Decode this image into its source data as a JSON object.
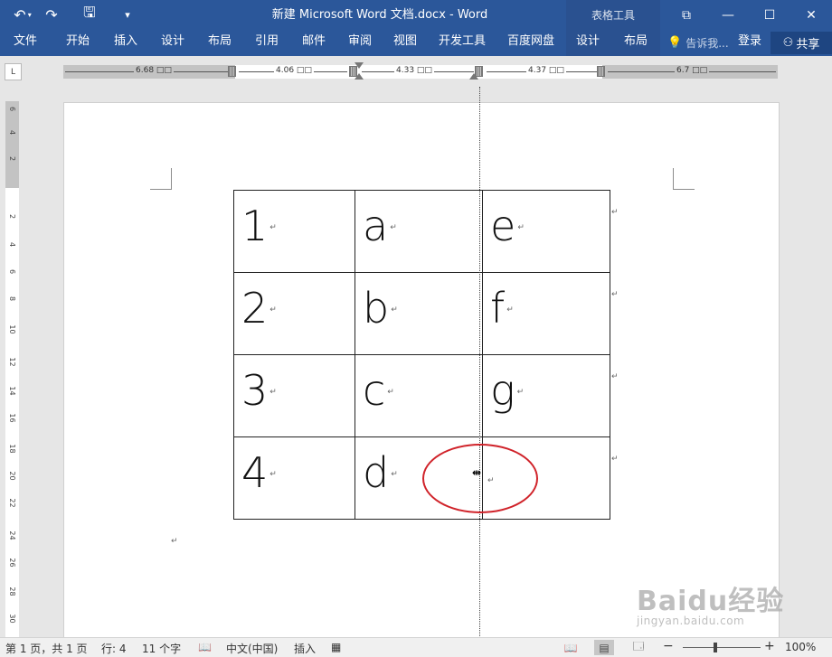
{
  "titlebar": {
    "title": "新建 Microsoft Word 文档.docx - Word",
    "context_group": "表格工具",
    "qat": {
      "undo_icon": "↶",
      "redo_icon": "↷",
      "save_icon": "🖫",
      "customize_icon": "▾"
    },
    "window": {
      "ribbon_display_icon": "⧉",
      "minimize_icon": "—",
      "maximize_icon": "☐",
      "close_icon": "✕"
    }
  },
  "ribbon": {
    "tabs": [
      "文件",
      "开始",
      "插入",
      "设计",
      "布局",
      "引用",
      "邮件",
      "审阅",
      "视图",
      "开发工具",
      "百度网盘"
    ],
    "context_tabs": [
      "设计",
      "布局"
    ],
    "tell_me": "告诉我...",
    "login": "登录",
    "share": "共享"
  },
  "ruler": {
    "tab_selector": "L",
    "segments": [
      "6.68 □□",
      "4.06 □□",
      "4.33 □□",
      "4.37 □□",
      "6.7 □□"
    ],
    "vertical_numbers": [
      "6",
      "4",
      "2",
      "",
      "2",
      "4",
      "6",
      "8",
      "10",
      "12",
      "14",
      "16",
      "18",
      "20",
      "22",
      "24",
      "26",
      "28",
      "30"
    ]
  },
  "table": {
    "rows": [
      [
        "1",
        "a",
        "e"
      ],
      [
        "2",
        "b",
        "f"
      ],
      [
        "3",
        "c",
        "g"
      ],
      [
        "4",
        "d",
        ""
      ]
    ],
    "para_mark": "↵"
  },
  "watermark": {
    "main": "Baidu经验",
    "sub": "jingyan.baidu.com"
  },
  "statusbar": {
    "page": "第 1 页，共 1 页",
    "line": "行: 4",
    "words": "11 个字",
    "language": "中文(中国)",
    "mode": "插入",
    "zoom_minus": "−",
    "zoom_plus": "+",
    "zoom": "100%",
    "zoom_level": 1.0
  }
}
